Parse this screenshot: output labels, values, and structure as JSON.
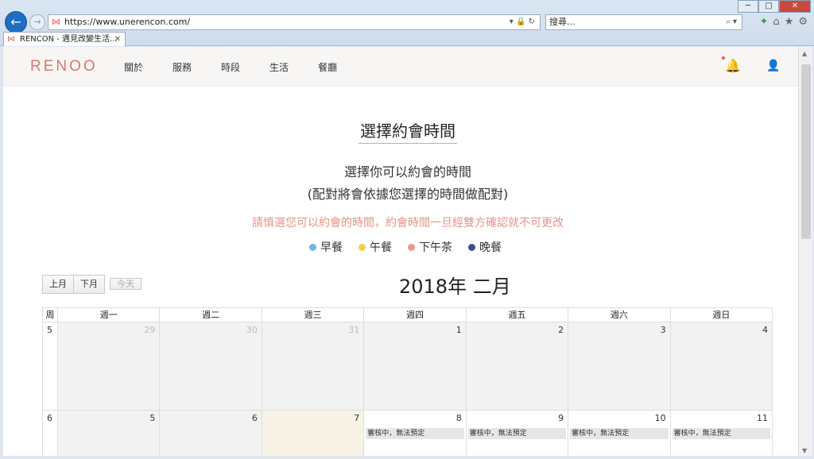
{
  "browser": {
    "url": "https://www.unerencon.com/",
    "search_placeholder": "搜尋...",
    "tab_title": "RENCON - 遇見改變生活...",
    "win_minimize": "─",
    "win_maximize": "□",
    "win_close": "✕"
  },
  "site": {
    "logo": "RENOO",
    "nav": [
      "關於",
      "服務",
      "時段",
      "生活",
      "餐廳"
    ]
  },
  "page": {
    "title": "選擇約會時間",
    "subtitle1": "選擇你可以約會的時間",
    "subtitle2": "(配對將會依據您選擇的時間做配對)",
    "warning": "請慎選您可以約會的時間，約會時間一旦經雙方確認就不可更改",
    "legend": [
      {
        "label": "早餐",
        "color": "#74b8dc"
      },
      {
        "label": "午餐",
        "color": "#f0d24a"
      },
      {
        "label": "下午茶",
        "color": "#ea9a8c"
      },
      {
        "label": "晚餐",
        "color": "#3d4f8c"
      }
    ]
  },
  "calendar": {
    "prev_label": "上月",
    "next_label": "下月",
    "today_label": "今天",
    "month_title": "2018年 二月",
    "headers": [
      "周",
      "週一",
      "週二",
      "週三",
      "週四",
      "週五",
      "週六",
      "週日"
    ],
    "weeks": [
      {
        "week": "5",
        "days": [
          "29",
          "30",
          "31",
          "1",
          "2",
          "3",
          "4"
        ]
      },
      {
        "week": "6",
        "days": [
          "5",
          "6",
          "7",
          "8",
          "9",
          "10",
          "11"
        ]
      }
    ],
    "event_label": "審核中，無法預定"
  }
}
